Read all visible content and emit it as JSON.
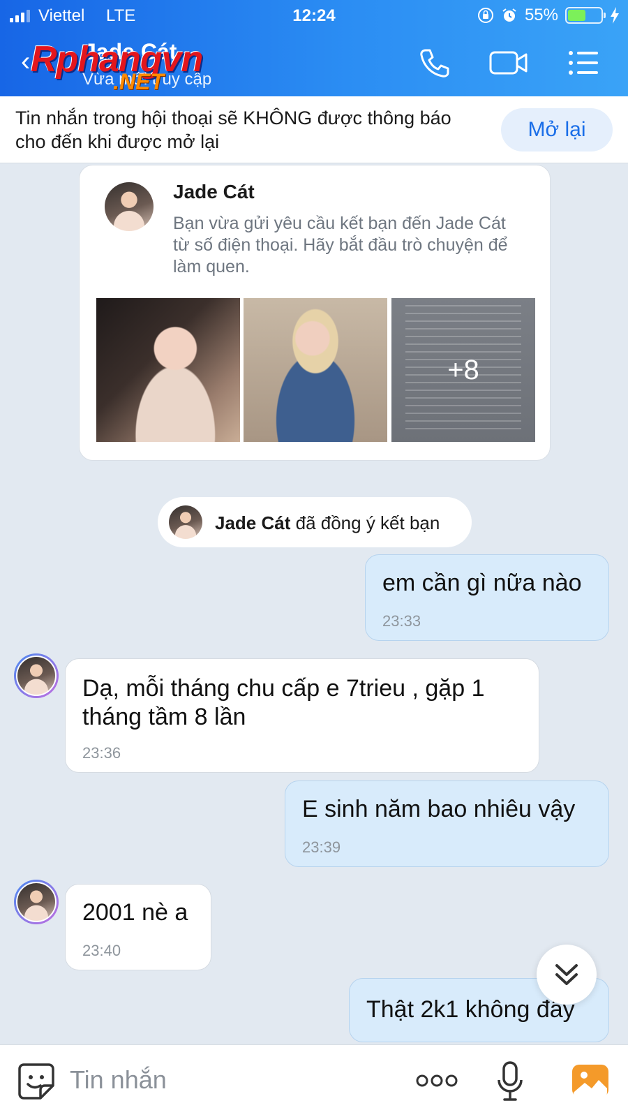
{
  "status_bar": {
    "carrier": "Viettel",
    "network": "LTE",
    "time": "12:24",
    "battery": "55%",
    "battery_level": 0.55
  },
  "header": {
    "contact_name": "Jade Cát",
    "contact_status": "Vừa mới truy cập",
    "watermark_main": "Rphangvn",
    "watermark_sub": ".NET",
    "icons": [
      "back-arrow",
      "phone-icon",
      "video-call-icon",
      "menu-list-icon"
    ]
  },
  "mute_banner": {
    "text": "Tin nhắn trong hội thoại sẽ KHÔNG được thông báo cho đến khi được mở lại",
    "reopen_label": "Mở lại"
  },
  "profile_card": {
    "name": "Jade Cát",
    "description": "Bạn vừa gửi yêu cầu kết bạn đến Jade Cát từ số điện thoại. Hãy bắt đầu trò chuyện để làm quen.",
    "more_photos": "+8"
  },
  "system_message": {
    "name": "Jade Cát",
    "text": " đã đồng ý kết bạn"
  },
  "messages": [
    {
      "from": "me",
      "text": "em cần gì nữa nào",
      "time": "23:33"
    },
    {
      "from": "them",
      "text": "Dạ, mỗi tháng chu cấp e 7trieu , gặp 1 tháng tầm 8 lần",
      "time": "23:36"
    },
    {
      "from": "me",
      "text": "E sinh năm bao nhiêu vậy",
      "time": "23:39"
    },
    {
      "from": "them",
      "text": "2001 nè a",
      "time": "23:40"
    },
    {
      "from": "me",
      "text": "Thật 2k1 không đây",
      "time": ""
    }
  ],
  "input_bar": {
    "placeholder": "Tin nhắn",
    "icons": [
      "sticker-icon",
      "more-dots-icon",
      "microphone-icon",
      "image-gallery-icon"
    ]
  },
  "colors": {
    "header_start": "#1766e6",
    "header_end": "#3aa3f7",
    "accent": "#1a6ee8",
    "my_bubble": "#d8ebfb",
    "background": "#e2e9f1"
  }
}
